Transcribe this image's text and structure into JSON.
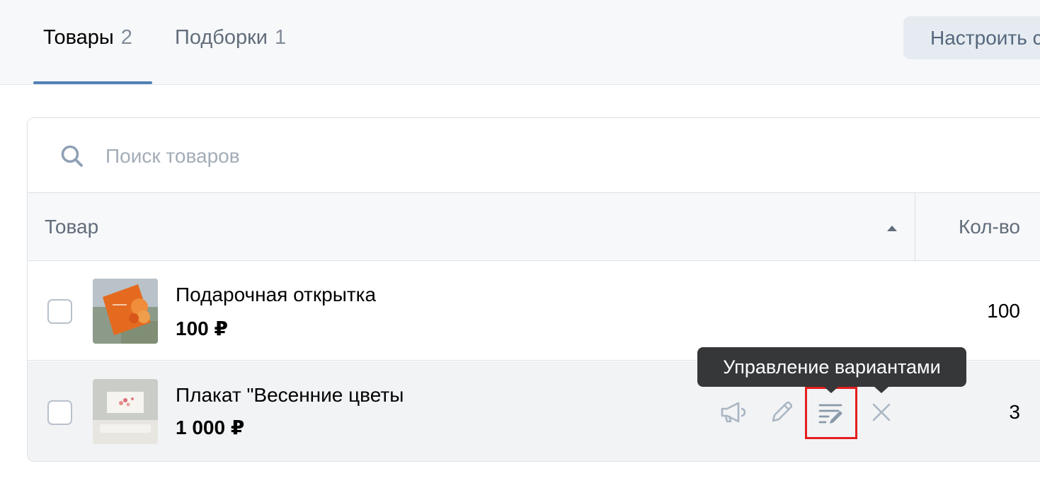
{
  "tabs": [
    {
      "label": "Товары",
      "count": "2"
    },
    {
      "label": "Подборки",
      "count": "1"
    }
  ],
  "configure_button": "Настроить с",
  "search": {
    "placeholder": "Поиск товаров"
  },
  "table": {
    "columns": {
      "product": "Товар",
      "quantity": "Кол-во"
    },
    "rows": [
      {
        "name": "Подарочная открытка",
        "price": "100 ₽",
        "quantity": "100"
      },
      {
        "name": "Плакат \"Весенние цветы",
        "price": "1 000 ₽",
        "quantity": "3"
      }
    ]
  },
  "tooltip": {
    "text": "Управление вариантами"
  },
  "colors": {
    "accent": "#5181b8",
    "highlight": "#e41e1e",
    "tooltip_bg": "#363739"
  }
}
